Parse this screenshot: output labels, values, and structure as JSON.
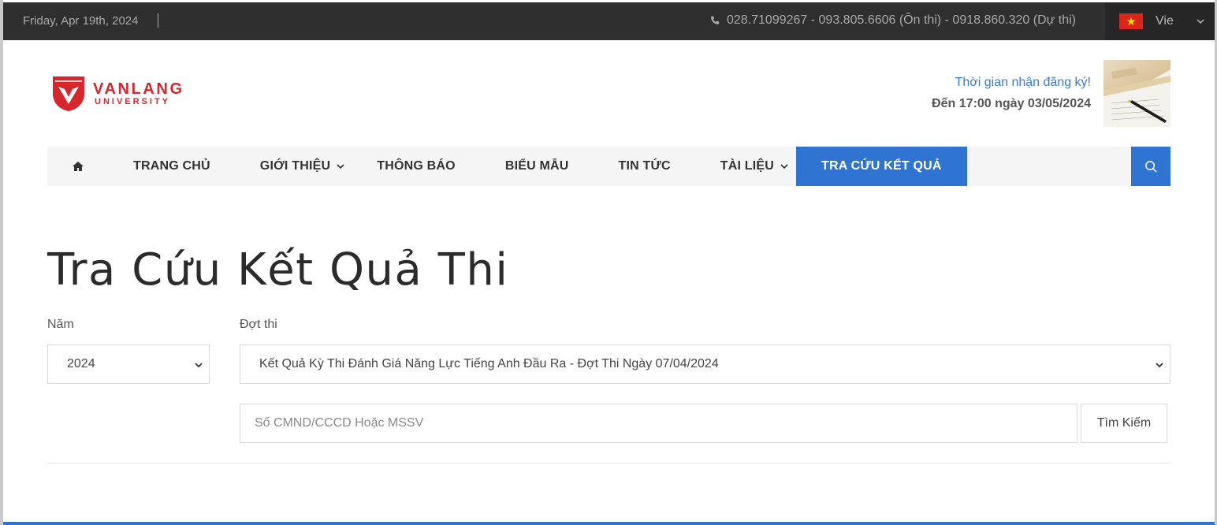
{
  "topbar": {
    "date": "Friday, Apr 19th, 2024",
    "phone": "028.71099267 - 093.805.6606 (Ôn thi) - 0918.860.320 (Dự thi)",
    "phone_icon": "phone-icon",
    "language": "Vie",
    "flag_icon": "vietnam-flag-icon"
  },
  "header": {
    "logo_line1": "VANLANG",
    "logo_line2": "UNIVERSITY",
    "registration_label": "Thời gian nhận đăng ký!",
    "registration_deadline": "Đến 17:00 ngày 03/05/2024"
  },
  "nav": {
    "home_icon": "home-icon",
    "items": [
      {
        "label": "TRANG CHỦ",
        "dropdown": false
      },
      {
        "label": "GIỚI THIỆU",
        "dropdown": true
      },
      {
        "label": "THÔNG BÁO",
        "dropdown": false
      },
      {
        "label": "BIỂU MẪU",
        "dropdown": false
      },
      {
        "label": "TIN TỨC",
        "dropdown": false
      },
      {
        "label": "TÀI LIỆU",
        "dropdown": true
      },
      {
        "label": "TRA CỨU KẾT QUẢ",
        "dropdown": false,
        "active": true
      }
    ],
    "search_icon": "search-icon"
  },
  "colors": {
    "accent": "#2f74d0",
    "brand": "#d7262c",
    "topbar": "#2f2f2f"
  },
  "main": {
    "title": "Tra Cứu Kết Quả Thi",
    "year_label": "Năm",
    "year_value": "2024",
    "exam_label": "Đợt thi",
    "exam_value": "Kết Quả Kỳ Thi Đánh Giá Năng Lực Tiếng Anh Đầu Ra - Đợt Thi Ngày 07/04/2024",
    "id_placeholder": "Số CMND/CCCD Hoặc MSSV",
    "search_button": "Tìm Kiếm"
  }
}
